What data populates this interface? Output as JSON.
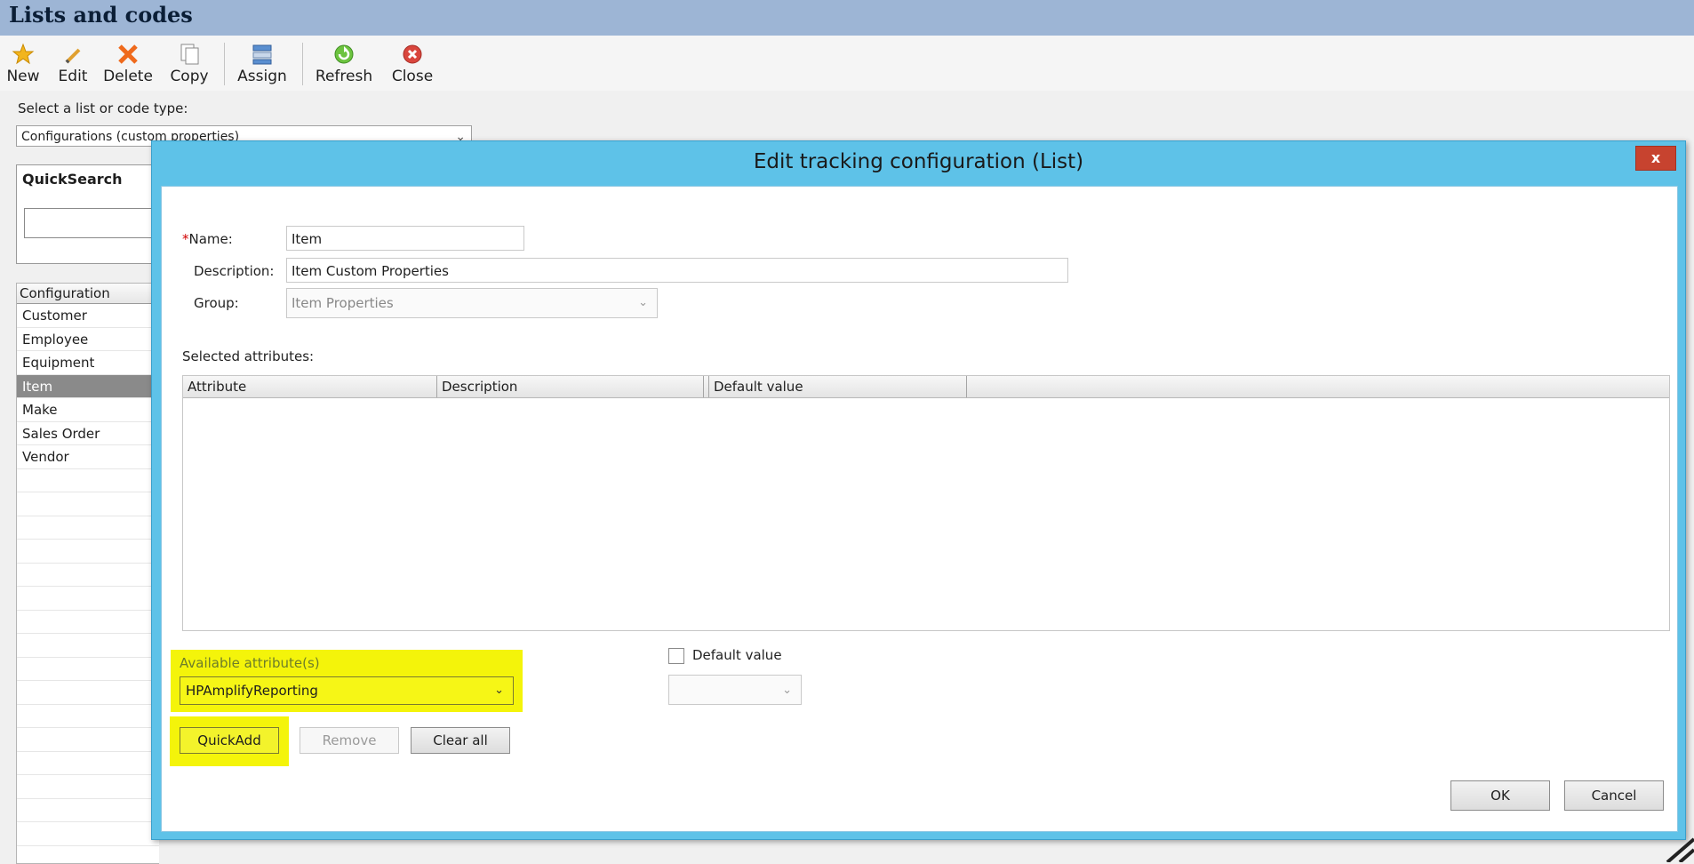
{
  "window": {
    "title": "Lists and codes"
  },
  "toolbar": {
    "buttons": [
      {
        "label": "New",
        "icon": "star-icon"
      },
      {
        "label": "Edit",
        "icon": "pencil-icon"
      },
      {
        "label": "Delete",
        "icon": "delete-x-icon"
      },
      {
        "label": "Copy",
        "icon": "copy-icon"
      },
      {
        "label": "Assign",
        "icon": "assign-icon"
      },
      {
        "label": "Refresh",
        "icon": "refresh-icon"
      },
      {
        "label": "Close",
        "icon": "close-circle-icon"
      }
    ]
  },
  "selector": {
    "label": "Select a list or code type:",
    "value": "Configurations (custom properties)"
  },
  "quicksearch": {
    "title": "QuickSearch",
    "value": ""
  },
  "config_list": {
    "header": "Configuration",
    "items": [
      "Customer",
      "Employee",
      "Equipment",
      "Item",
      "Make",
      "Sales Order",
      "Vendor"
    ],
    "selected": "Item"
  },
  "dialog": {
    "title": "Edit tracking configuration (List)",
    "close_label": "x",
    "name_label": "Name:",
    "name_required_mark": "*",
    "name_value": "Item",
    "description_label": "Description:",
    "description_value": "Item Custom Properties",
    "group_label": "Group:",
    "group_value": "Item Properties",
    "selected_attributes_label": "Selected attributes:",
    "grid_columns": [
      "Attribute",
      "Description",
      "Default value"
    ],
    "grid_rows": [],
    "available_label": "Available attribute(s)",
    "available_value": "HPAmplifyReporting",
    "default_value_label": "Default value",
    "default_value_checked": false,
    "default_value_select": "",
    "quickadd_label": "QuickAdd",
    "remove_label": "Remove",
    "clear_all_label": "Clear all",
    "ok_label": "OK",
    "cancel_label": "Cancel"
  },
  "colors": {
    "titlebar": "#9db5d5",
    "dialog_frame": "#5ec2e8",
    "highlight": "#f4f40a",
    "close_button": "#c7432f",
    "selected_row": "#8a8a8a"
  }
}
